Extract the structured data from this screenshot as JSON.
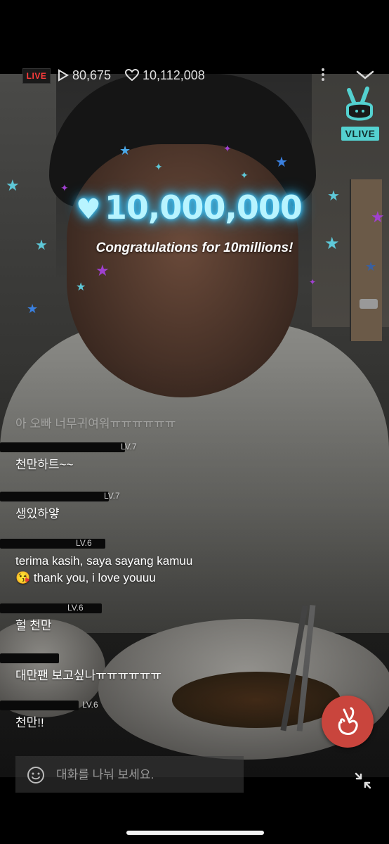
{
  "header": {
    "live_label": "LIVE",
    "view_count": "80,675",
    "like_count": "10,112,008",
    "logo_text": "VLIVE"
  },
  "celebration": {
    "count": "10,000,000",
    "message": "Congratulations for 10millions!"
  },
  "chat": {
    "messages": [
      {
        "nick": "",
        "level": "",
        "text": "아 오빠 너무귀여워ㅠㅠㅠㅠㅠㅠ"
      },
      {
        "nick": "",
        "level": "LV.7",
        "text": "천만하트~~"
      },
      {
        "nick": "",
        "level": "LV.7",
        "text": "생있하얗"
      },
      {
        "nick": "",
        "level": "LV.6",
        "text": "terima kasih, saya sayang kamuu"
      },
      {
        "nick": "",
        "level": "",
        "text": "😘 thank you, i love youuu"
      },
      {
        "nick": "",
        "level": "LV.6",
        "text": "헐 천만"
      },
      {
        "nick": "",
        "level": "",
        "text": "대만팬 보고싶나ㅠㅠㅠㅠㅠㅠ"
      },
      {
        "nick": "",
        "level": "LV.6",
        "text": "천만!!"
      }
    ]
  },
  "input": {
    "placeholder": "대화를 나눠 보세요."
  },
  "colors": {
    "live_red": "#ff3c3c",
    "vlive_teal": "#54d1d0",
    "heart_button": "#c9453d",
    "glow_cyan": "#3ec8ff"
  }
}
